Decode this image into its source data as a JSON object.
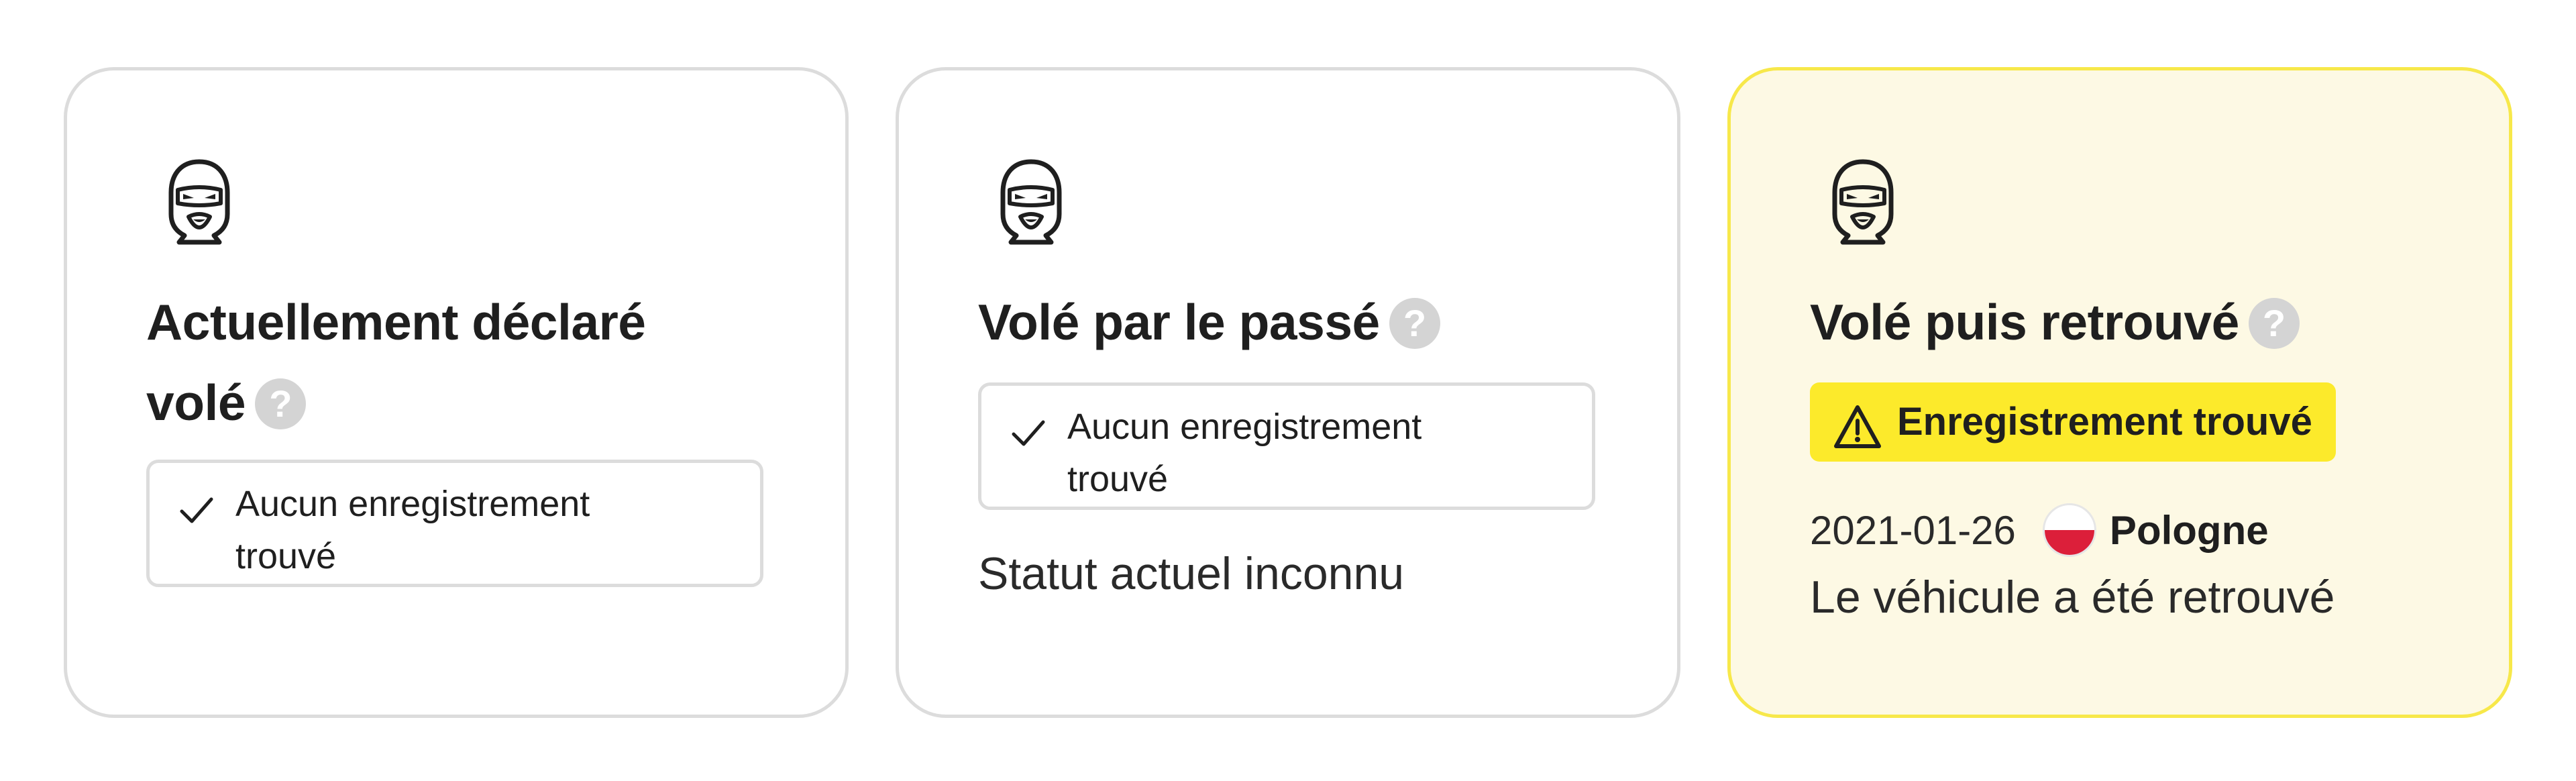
{
  "cards": [
    {
      "icon": "balaclava-thief-icon",
      "title_line1": "Actuellement déclaré",
      "title_line2": "volé",
      "help_label": "?",
      "result_icon": "check-icon",
      "result_line1": "Aucun enregistrement",
      "result_line2": "trouvé"
    },
    {
      "icon": "balaclava-thief-icon",
      "title": "Volé par le passé",
      "help_label": "?",
      "result_icon": "check-icon",
      "result_line1": "Aucun enregistrement",
      "result_line2": "trouvé",
      "status": "Statut actuel inconnu"
    },
    {
      "icon": "balaclava-thief-icon",
      "title": "Volé puis retrouvé",
      "help_label": "?",
      "badge_icon": "warning-triangle-icon",
      "badge_label": "Enregistrement trouvé",
      "record_date": "2021-01-26",
      "record_flag": "poland-flag-icon",
      "record_country": "Pologne",
      "record_note": "Le véhicule a été retrouvé"
    }
  ],
  "colors": {
    "card_border": "#dcdcdc",
    "highlight_background": "#fdf9e4",
    "highlight_border": "#f7e84a",
    "badge_background": "#fcea2b",
    "help_icon_background": "#d4d4d4",
    "text": "#1f1f1f",
    "flag_red": "#dc1f3a"
  }
}
